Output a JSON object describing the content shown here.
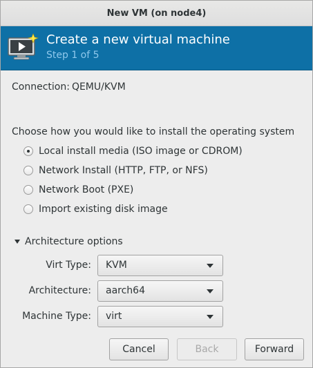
{
  "window": {
    "title": "New VM (on node4)"
  },
  "banner": {
    "heading": "Create a new virtual machine",
    "step": "Step 1 of 5"
  },
  "connection": {
    "label": "Connection:",
    "value": "QEMU/KVM"
  },
  "install": {
    "question": "Choose how you would like to install the operating system",
    "options": [
      {
        "label": "Local install media (ISO image or CDROM)",
        "checked": true
      },
      {
        "label": "Network Install (HTTP, FTP, or NFS)",
        "checked": false
      },
      {
        "label": "Network Boot (PXE)",
        "checked": false
      },
      {
        "label": "Import existing disk image",
        "checked": false
      }
    ]
  },
  "arch": {
    "expander_label": "Architecture options",
    "virt_type": {
      "label": "Virt Type:",
      "value": "KVM"
    },
    "architecture": {
      "label": "Architecture:",
      "value": "aarch64"
    },
    "machine_type": {
      "label": "Machine Type:",
      "value": "virt"
    }
  },
  "buttons": {
    "cancel": "Cancel",
    "back": "Back",
    "forward": "Forward"
  },
  "colors": {
    "banner": "#0e70a6",
    "step_text": "#8fc8ec"
  },
  "icons": {
    "banner": "monitor-play-sparkle-icon"
  }
}
